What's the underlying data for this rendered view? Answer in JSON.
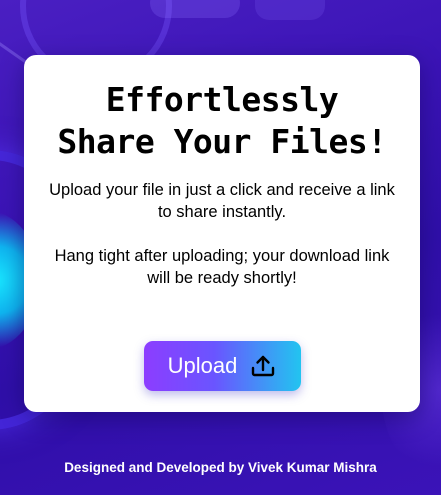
{
  "card": {
    "title_line1": "Effortlessly",
    "title_line2": "Share Your Files!",
    "desc_para1": "Upload your file in just a click and receive a link to share instantly.",
    "desc_para2": "Hang tight after uploading; your download link will be ready shortly!",
    "upload_button_label": "Upload",
    "upload_icon": "upload-icon"
  },
  "footer": {
    "credit": "Designed and Developed by Vivek Kumar Mishra"
  },
  "colors": {
    "background": "#3a13b5",
    "card": "#ffffff",
    "button_gradient_start": "#8c3dff",
    "button_gradient_end": "#22c4f0",
    "accent_glow": "#19e6ff"
  }
}
